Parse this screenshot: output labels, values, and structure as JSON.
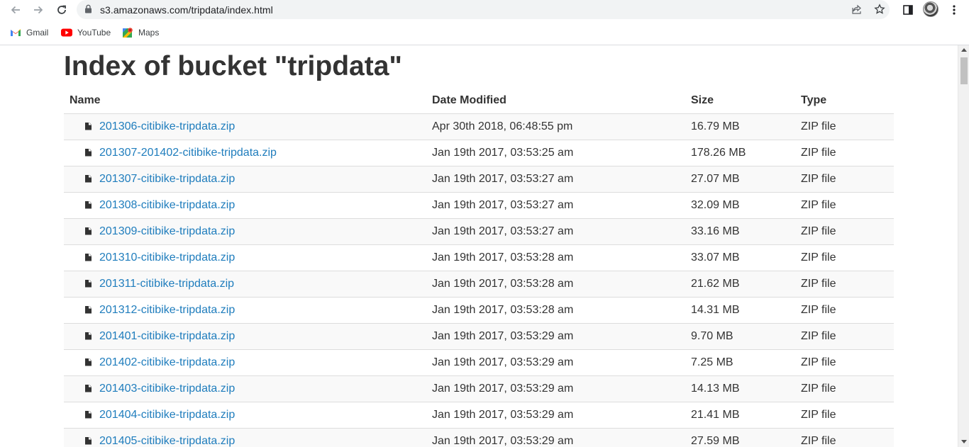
{
  "browser": {
    "url": "s3.amazonaws.com/tripdata/index.html",
    "bookmarks": [
      {
        "label": "Gmail",
        "icon": "gmail-icon"
      },
      {
        "label": "YouTube",
        "icon": "youtube-icon"
      },
      {
        "label": "Maps",
        "icon": "maps-icon"
      }
    ]
  },
  "page": {
    "title": "Index of bucket \"tripdata\"",
    "columns": {
      "name": "Name",
      "date": "Date Modified",
      "size": "Size",
      "type": "Type"
    },
    "files": [
      {
        "name": "201306-citibike-tripdata.zip",
        "date": "Apr 30th 2018, 06:48:55 pm",
        "size": "16.79 MB",
        "type": "ZIP file"
      },
      {
        "name": "201307-201402-citibike-tripdata.zip",
        "date": "Jan 19th 2017, 03:53:25 am",
        "size": "178.26 MB",
        "type": "ZIP file"
      },
      {
        "name": "201307-citibike-tripdata.zip",
        "date": "Jan 19th 2017, 03:53:27 am",
        "size": "27.07 MB",
        "type": "ZIP file"
      },
      {
        "name": "201308-citibike-tripdata.zip",
        "date": "Jan 19th 2017, 03:53:27 am",
        "size": "32.09 MB",
        "type": "ZIP file"
      },
      {
        "name": "201309-citibike-tripdata.zip",
        "date": "Jan 19th 2017, 03:53:27 am",
        "size": "33.16 MB",
        "type": "ZIP file"
      },
      {
        "name": "201310-citibike-tripdata.zip",
        "date": "Jan 19th 2017, 03:53:28 am",
        "size": "33.07 MB",
        "type": "ZIP file"
      },
      {
        "name": "201311-citibike-tripdata.zip",
        "date": "Jan 19th 2017, 03:53:28 am",
        "size": "21.62 MB",
        "type": "ZIP file"
      },
      {
        "name": "201312-citibike-tripdata.zip",
        "date": "Jan 19th 2017, 03:53:28 am",
        "size": "14.31 MB",
        "type": "ZIP file"
      },
      {
        "name": "201401-citibike-tripdata.zip",
        "date": "Jan 19th 2017, 03:53:29 am",
        "size": "9.70 MB",
        "type": "ZIP file"
      },
      {
        "name": "201402-citibike-tripdata.zip",
        "date": "Jan 19th 2017, 03:53:29 am",
        "size": "7.25 MB",
        "type": "ZIP file"
      },
      {
        "name": "201403-citibike-tripdata.zip",
        "date": "Jan 19th 2017, 03:53:29 am",
        "size": "14.13 MB",
        "type": "ZIP file"
      },
      {
        "name": "201404-citibike-tripdata.zip",
        "date": "Jan 19th 2017, 03:53:29 am",
        "size": "21.41 MB",
        "type": "ZIP file"
      },
      {
        "name": "201405-citibike-tripdata.zip",
        "date": "Jan 19th 2017, 03:53:29 am",
        "size": "27.59 MB",
        "type": "ZIP file"
      }
    ]
  },
  "colors": {
    "link": "#1f7dbd",
    "text": "#333333",
    "row_stripe": "#f9f9f9",
    "omnibox": "#f1f3f4"
  }
}
